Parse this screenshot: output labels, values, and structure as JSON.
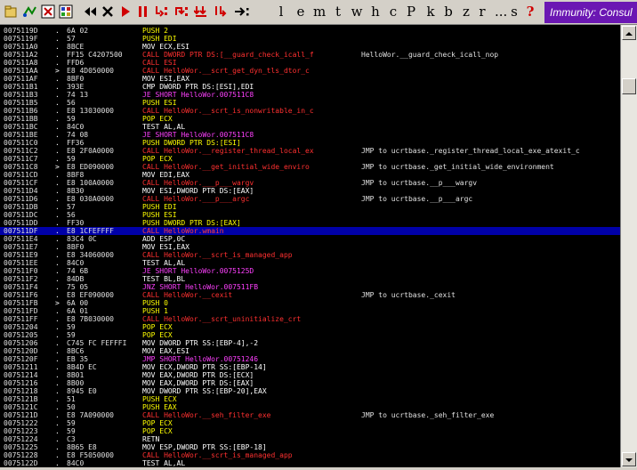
{
  "toolbar": {
    "buttons": [
      {
        "name": "open-file-icon"
      },
      {
        "name": "restart-icon"
      },
      {
        "name": "breakpoints-window-icon"
      },
      {
        "name": "modules-window-icon"
      },
      {
        "name": "rewind-icon",
        "glyph": "◀◀"
      },
      {
        "name": "close-process-icon",
        "glyph": "✕"
      },
      {
        "name": "run-icon",
        "glyph": "▶"
      },
      {
        "name": "pause-icon",
        "glyph": "❚❚"
      },
      {
        "name": "step-into-icon"
      },
      {
        "name": "step-over-icon"
      },
      {
        "name": "trace-into-icon"
      },
      {
        "name": "trace-over-icon"
      },
      {
        "name": "execute-till-return-icon",
        "glyph": "→:"
      }
    ],
    "letters": [
      "l",
      "e",
      "m",
      "t",
      "w",
      "h",
      "c",
      "P",
      "k",
      "b",
      "z",
      "r",
      "...",
      "s",
      "?"
    ],
    "brand": "Immunity: Consul"
  },
  "disasm": {
    "rows": [
      {
        "addr": "0075119D",
        "mark": ".",
        "hex": "6A 02",
        "op": "push",
        "ins": "PUSH 2",
        "cmt": ""
      },
      {
        "addr": "0075119F",
        "mark": ".",
        "hex": "57",
        "op": "push",
        "ins": "PUSH EDI",
        "cmt": ""
      },
      {
        "addr": "007511A0",
        "mark": ".",
        "hex": "8BCE",
        "op": "mov",
        "ins": "MOV ECX,ESI",
        "cmt": ""
      },
      {
        "addr": "007511A2",
        "mark": ".",
        "hex": "FF15 C4207500",
        "op": "call",
        "ins": "CALL DWORD PTR DS:[__guard_check_icall_f",
        "cmt": "HelloWor.__guard_check_icall_nop"
      },
      {
        "addr": "007511A8",
        "mark": ".",
        "hex": "FFD6",
        "op": "call",
        "ins": "CALL ESI",
        "cmt": ""
      },
      {
        "addr": "007511AA",
        "mark": ">",
        "hex": "E8 4D050000",
        "op": "call",
        "ins": "CALL HelloWor.__scrt_get_dyn_tls_dtor_c",
        "cmt": ""
      },
      {
        "addr": "007511AF",
        "mark": ".",
        "hex": "8BF0",
        "op": "mov",
        "ins": "MOV ESI,EAX",
        "cmt": ""
      },
      {
        "addr": "007511B1",
        "mark": ".",
        "hex": "393E",
        "op": "cmp",
        "ins": "CMP DWORD PTR DS:[ESI],EDI",
        "cmt": ""
      },
      {
        "addr": "007511B3",
        "mark": ".",
        "hex": "74 13",
        "op": "je",
        "ins": "JE SHORT HelloWor.007511C8",
        "cmt": ""
      },
      {
        "addr": "007511B5",
        "mark": ".",
        "hex": "56",
        "op": "push",
        "ins": "PUSH ESI",
        "cmt": ""
      },
      {
        "addr": "007511B6",
        "mark": ".",
        "hex": "E8 13030000",
        "op": "call",
        "ins": "CALL HelloWor.__scrt_is_nonwritable_in_c",
        "cmt": ""
      },
      {
        "addr": "007511BB",
        "mark": ".",
        "hex": "59",
        "op": "pop",
        "ins": "POP ECX",
        "cmt": ""
      },
      {
        "addr": "007511BC",
        "mark": ".",
        "hex": "84C0",
        "op": "test",
        "ins": "TEST AL,AL",
        "cmt": ""
      },
      {
        "addr": "007511BE",
        "mark": ".",
        "hex": "74 08",
        "op": "je",
        "ins": "JE SHORT HelloWor.007511C8",
        "cmt": ""
      },
      {
        "addr": "007511C0",
        "mark": ".",
        "hex": "FF36",
        "op": "push",
        "ins": "PUSH DWORD PTR DS:[ESI]",
        "cmt": ""
      },
      {
        "addr": "007511C2",
        "mark": ".",
        "hex": "E8 2F0A0000",
        "op": "call",
        "ins": "CALL HelloWor.__register_thread_local_ex",
        "cmt": "JMP to ucrtbase._register_thread_local_exe_atexit_c"
      },
      {
        "addr": "007511C7",
        "mark": ".",
        "hex": "59",
        "op": "pop",
        "ins": "POP ECX",
        "cmt": ""
      },
      {
        "addr": "007511C8",
        "mark": ">",
        "hex": "E8 ED090000",
        "op": "call",
        "ins": "CALL HelloWor.__get_initial_wide_enviro",
        "cmt": "JMP to ucrtbase._get_initial_wide_environment"
      },
      {
        "addr": "007511CD",
        "mark": ".",
        "hex": "8BF8",
        "op": "mov",
        "ins": "MOV EDI,EAX",
        "cmt": ""
      },
      {
        "addr": "007511CF",
        "mark": ".",
        "hex": "E8 100A0000",
        "op": "call",
        "ins": "CALL HelloWor.___p___wargv",
        "cmt": "JMP to ucrtbase.__p___wargv"
      },
      {
        "addr": "007511D4",
        "mark": ".",
        "hex": "8B30",
        "op": "mov",
        "ins": "MOV ESI,DWORD PTR DS:[EAX]",
        "cmt": ""
      },
      {
        "addr": "007511D6",
        "mark": ".",
        "hex": "E8 030A0000",
        "op": "call",
        "ins": "CALL HelloWor.___p___argc",
        "cmt": "JMP to ucrtbase.__p___argc"
      },
      {
        "addr": "007511DB",
        "mark": ".",
        "hex": "57",
        "op": "push",
        "ins": "PUSH EDI",
        "cmt": ""
      },
      {
        "addr": "007511DC",
        "mark": ".",
        "hex": "56",
        "op": "push",
        "ins": "PUSH ESI",
        "cmt": ""
      },
      {
        "addr": "007511DD",
        "mark": ".",
        "hex": "FF30",
        "op": "push",
        "ins": "PUSH DWORD PTR DS:[EAX]",
        "cmt": ""
      },
      {
        "addr": "007511DF",
        "mark": ".",
        "hex": "E8 1CFEFFFF",
        "op": "call",
        "ins": "CALL HelloWor.wmain",
        "cmt": "",
        "selected": true
      },
      {
        "addr": "007511E4",
        "mark": ".",
        "hex": "83C4 0C",
        "op": "add",
        "ins": "ADD ESP,0C",
        "cmt": ""
      },
      {
        "addr": "007511E7",
        "mark": ".",
        "hex": "8BF0",
        "op": "mov",
        "ins": "MOV ESI,EAX",
        "cmt": ""
      },
      {
        "addr": "007511E9",
        "mark": ".",
        "hex": "E8 34060000",
        "op": "call",
        "ins": "CALL HelloWor.__scrt_is_managed_app",
        "cmt": ""
      },
      {
        "addr": "007511EE",
        "mark": ".",
        "hex": "84C0",
        "op": "test",
        "ins": "TEST AL,AL",
        "cmt": ""
      },
      {
        "addr": "007511F0",
        "mark": ".",
        "hex": "74 6B",
        "op": "je",
        "ins": "JE SHORT HelloWor.0075125D",
        "cmt": ""
      },
      {
        "addr": "007511F2",
        "mark": ".",
        "hex": "84DB",
        "op": "test",
        "ins": "TEST BL,BL",
        "cmt": ""
      },
      {
        "addr": "007511F4",
        "mark": ".",
        "hex": "75 05",
        "op": "jnz",
        "ins": "JNZ SHORT HelloWor.007511FB",
        "cmt": ""
      },
      {
        "addr": "007511F6",
        "mark": ".",
        "hex": "E8 EF090000",
        "op": "call",
        "ins": "CALL HelloWor.__cexit",
        "cmt": "JMP to ucrtbase._cexit"
      },
      {
        "addr": "007511FB",
        "mark": ">",
        "hex": "6A 00",
        "op": "push",
        "ins": "PUSH 0",
        "cmt": ""
      },
      {
        "addr": "007511FD",
        "mark": ".",
        "hex": "6A 01",
        "op": "push",
        "ins": "PUSH 1",
        "cmt": ""
      },
      {
        "addr": "007511FF",
        "mark": ".",
        "hex": "E8 7B030000",
        "op": "call",
        "ins": "CALL HelloWor.__scrt_uninitialize_crt",
        "cmt": ""
      },
      {
        "addr": "00751204",
        "mark": ".",
        "hex": "59",
        "op": "pop",
        "ins": "POP ECX",
        "cmt": ""
      },
      {
        "addr": "00751205",
        "mark": ".",
        "hex": "59",
        "op": "pop",
        "ins": "POP ECX",
        "cmt": ""
      },
      {
        "addr": "00751206",
        "mark": ".",
        "hex": "C745 FC FEFFFI",
        "op": "mov",
        "ins": "MOV DWORD PTR SS:[EBP-4],-2",
        "cmt": ""
      },
      {
        "addr": "0075120D",
        "mark": ".",
        "hex": "8BC6",
        "op": "mov",
        "ins": "MOV EAX,ESI",
        "cmt": ""
      },
      {
        "addr": "0075120F",
        "mark": ".",
        "hex": "EB 35",
        "op": "jmp",
        "ins": "JMP SHORT HelloWor.00751246",
        "cmt": ""
      },
      {
        "addr": "00751211",
        "mark": ".",
        "hex": "8B4D EC",
        "op": "mov",
        "ins": "MOV ECX,DWORD PTR SS:[EBP-14]",
        "cmt": ""
      },
      {
        "addr": "00751214",
        "mark": ".",
        "hex": "8B01",
        "op": "mov",
        "ins": "MOV EAX,DWORD PTR DS:[ECX]",
        "cmt": ""
      },
      {
        "addr": "00751216",
        "mark": ".",
        "hex": "8B00",
        "op": "mov",
        "ins": "MOV EAX,DWORD PTR DS:[EAX]",
        "cmt": ""
      },
      {
        "addr": "00751218",
        "mark": ".",
        "hex": "8945 E0",
        "op": "mov",
        "ins": "MOV DWORD PTR SS:[EBP-20],EAX",
        "cmt": ""
      },
      {
        "addr": "0075121B",
        "mark": ".",
        "hex": "51",
        "op": "push",
        "ins": "PUSH ECX",
        "cmt": ""
      },
      {
        "addr": "0075121C",
        "mark": ".",
        "hex": "50",
        "op": "push",
        "ins": "PUSH EAX",
        "cmt": ""
      },
      {
        "addr": "0075121D",
        "mark": ".",
        "hex": "E8 7A090000",
        "op": "call",
        "ins": "CALL HelloWor.__seh_filter_exe",
        "cmt": "JMP to ucrtbase._seh_filter_exe"
      },
      {
        "addr": "00751222",
        "mark": ".",
        "hex": "59",
        "op": "pop",
        "ins": "POP ECX",
        "cmt": ""
      },
      {
        "addr": "00751223",
        "mark": ".",
        "hex": "59",
        "op": "pop",
        "ins": "POP ECX",
        "cmt": ""
      },
      {
        "addr": "00751224",
        "mark": ".",
        "hex": "C3",
        "op": "retn",
        "ins": "RETN",
        "cmt": ""
      },
      {
        "addr": "00751225",
        "mark": ".",
        "hex": "8B65 E8",
        "op": "mov",
        "ins": "MOV ESP,DWORD PTR SS:[EBP-18]",
        "cmt": ""
      },
      {
        "addr": "00751228",
        "mark": ".",
        "hex": "E8 F5050000",
        "op": "call",
        "ins": "CALL HelloWor.__scrt_is_managed_app",
        "cmt": ""
      },
      {
        "addr": "0075122D",
        "mark": ".",
        "hex": "84C0",
        "op": "test",
        "ins": "TEST AL,AL",
        "cmt": ""
      }
    ]
  },
  "colors": {
    "brand_bg": "#6b17b3",
    "selection_bg": "#0000a8",
    "call": "#ff3030",
    "jump": "#ff40ff",
    "stack": "#ffff00"
  }
}
